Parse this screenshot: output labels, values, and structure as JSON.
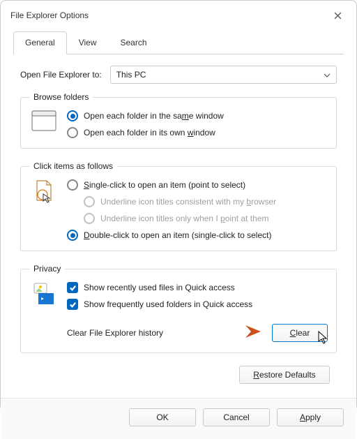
{
  "window": {
    "title": "File Explorer Options"
  },
  "tabs": {
    "general": "General",
    "view": "View",
    "search": "Search"
  },
  "open_to": {
    "label": "Open File Explorer to:",
    "value": "This PC"
  },
  "browse": {
    "legend": "Browse folders",
    "same": "Open each folder in the same window",
    "own": "Open each folder in its own window"
  },
  "click_items": {
    "legend": "Click items as follows",
    "single": "Single-click to open an item (point to select)",
    "underline_browser": "Underline icon titles consistent with my browser",
    "underline_point": "Underline icon titles only when I point at them",
    "double": "Double-click to open an item (single-click to select)"
  },
  "privacy": {
    "legend": "Privacy",
    "recent_files": "Show recently used files in Quick access",
    "frequent_folders": "Show frequently used folders in Quick access",
    "clear_history_label": "Clear File Explorer history",
    "clear_btn": "Clear"
  },
  "restore_defaults": "Restore Defaults",
  "buttons": {
    "ok": "OK",
    "cancel": "Cancel",
    "apply": "Apply"
  }
}
